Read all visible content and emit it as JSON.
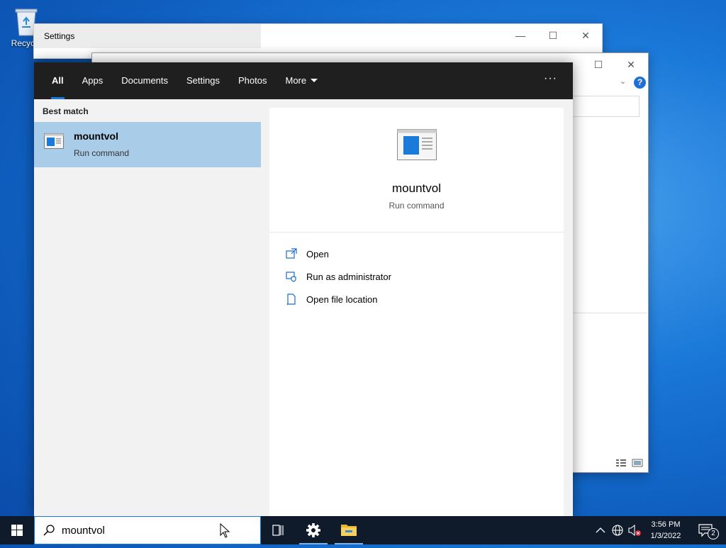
{
  "desktop": {
    "recycle_label": "Recycle"
  },
  "settings_window": {
    "title": "Settings"
  },
  "explorer_window": {
    "help": "?"
  },
  "search": {
    "tabs": [
      {
        "label": "All"
      },
      {
        "label": "Apps"
      },
      {
        "label": "Documents"
      },
      {
        "label": "Settings"
      },
      {
        "label": "Photos"
      },
      {
        "label": "More"
      }
    ],
    "more_options": "···",
    "best_match_label": "Best match",
    "result": {
      "name": "mountvol",
      "type": "Run command"
    },
    "detail": {
      "name": "mountvol",
      "type": "Run command",
      "actions": [
        {
          "label": "Open"
        },
        {
          "label": "Run as administrator"
        },
        {
          "label": "Open file location"
        }
      ]
    },
    "query": "mountvol"
  },
  "taskbar": {
    "time": "3:56 PM",
    "date": "1/3/2022",
    "notification_count": "2"
  },
  "colors": {
    "accent": "#1a7ad9",
    "selection": "#a9cde9",
    "taskbar": "#0f1a2b"
  }
}
